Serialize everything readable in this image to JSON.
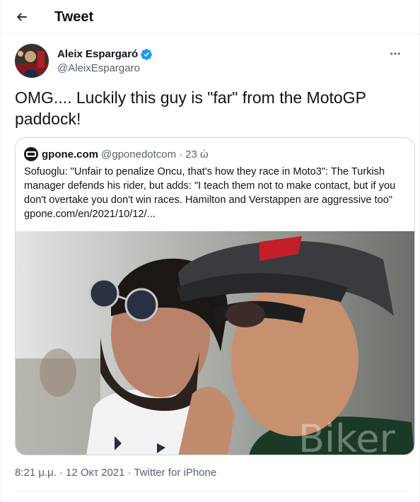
{
  "header": {
    "title": "Tweet",
    "back_icon": "arrow-left-icon"
  },
  "author": {
    "display_name": "Aleix Espargaró",
    "handle": "@AleixEspargaro",
    "verified": true,
    "verified_color": "#1d9bf0"
  },
  "tweet": {
    "text": "OMG.... Luckily this guy is \"far\" from the MotoGP paddock!"
  },
  "quote": {
    "display_name": "gpone.com",
    "handle": "@gponedotcom",
    "separator": "·",
    "time": "23 ώ",
    "text": "Sofuoglu: \"Unfair to penalize Oncu, that's how they race in Moto3\": The Turkish manager defends his rider, but adds: \"I teach them not to make contact, but if you don't overtake you don't win races. Hamilton and Verstappen are aggressive too\" gpone.com/en/2021/10/12/...",
    "photo": {
      "description_icon": "photo-two-men-sunglasses",
      "watermark": "Biker"
    }
  },
  "meta": {
    "time": "8:21 μ.μ.",
    "separator": "·",
    "date": "12 Οκτ 2021",
    "source": "Twitter for iPhone"
  },
  "colors": {
    "text": "#0f1419",
    "secondary": "#536471",
    "border": "#cfd9de",
    "accent": "#1d9bf0"
  }
}
